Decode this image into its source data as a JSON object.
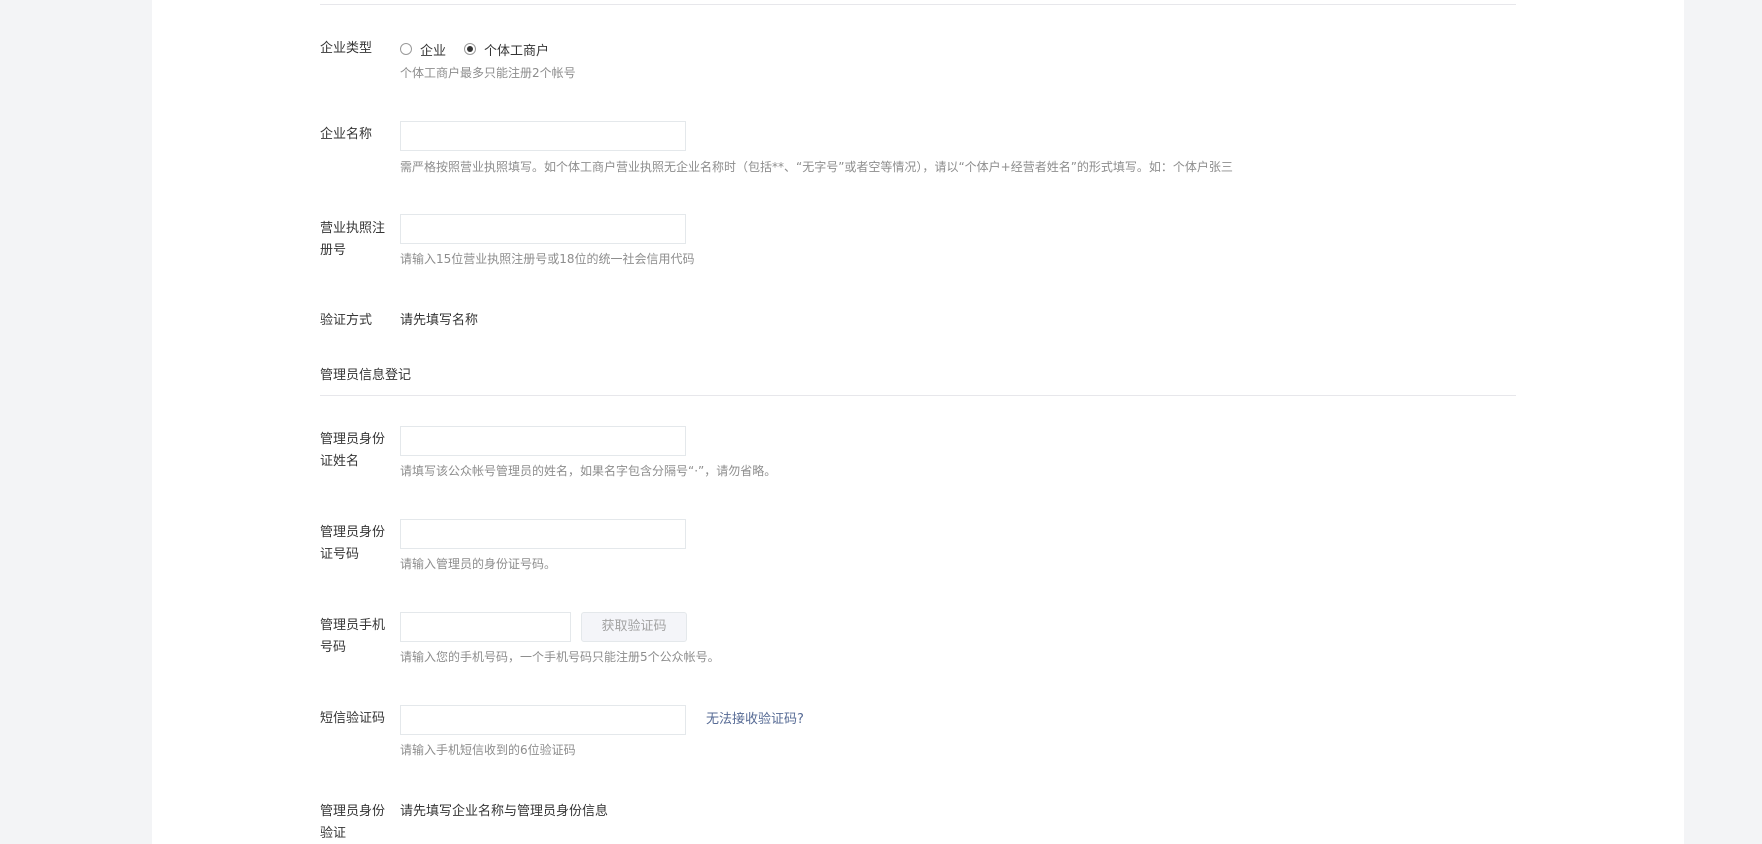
{
  "company_type": {
    "label": "企业类型",
    "options": [
      {
        "label": "企业",
        "checked": false
      },
      {
        "label": "个体工商户",
        "checked": true
      }
    ],
    "tip": "个体工商户最多只能注册2个帐号"
  },
  "company_name": {
    "label": "企业名称",
    "value": "",
    "tip": "需严格按照营业执照填写。如个体工商户营业执照无企业名称时（包括**、“无字号”或者空等情况），请以“个体户+经营者姓名”的形式填写。如：个体户张三"
  },
  "license_number": {
    "label": "营业执照注册号",
    "value": "",
    "tip": "请输入15位营业执照注册号或18位的统一社会信用代码"
  },
  "verify_method": {
    "label": "验证方式",
    "value": "请先填写名称"
  },
  "admin_section": {
    "title": "管理员信息登记"
  },
  "admin_name": {
    "label": "管理员身份证姓名",
    "value": "",
    "tip": "请填写该公众帐号管理员的姓名，如果名字包含分隔号“·”，请勿省略。"
  },
  "admin_id": {
    "label": "管理员身份证号码",
    "value": "",
    "tip": "请输入管理员的身份证号码。"
  },
  "admin_phone": {
    "label": "管理员手机号码",
    "value": "",
    "get_code_label": "获取验证码",
    "tip": "请输入您的手机号码，一个手机号码只能注册5个公众帐号。"
  },
  "sms_code": {
    "label": "短信验证码",
    "value": "",
    "link": "无法接收验证码?",
    "tip": "请输入手机短信收到的6位验证码"
  },
  "admin_verify": {
    "label": "管理员身份验证",
    "value": "请先填写企业名称与管理员身份信息"
  }
}
